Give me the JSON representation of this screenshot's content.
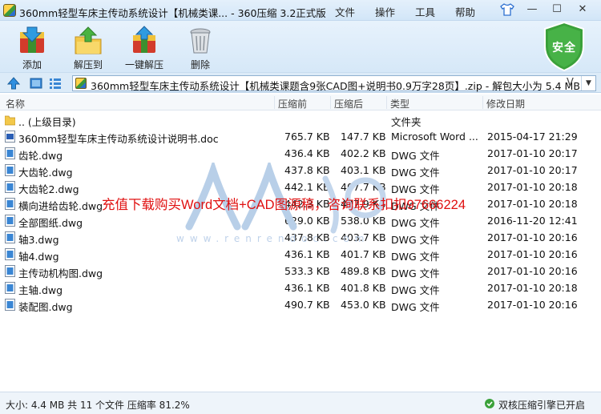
{
  "window": {
    "title": "360mm轻型车床主传动系统设计【机械类课... - 360压缩 3.2正式版",
    "menu": [
      "文件",
      "操作",
      "工具",
      "帮助"
    ],
    "controls": {
      "minimize": "—",
      "maximize": "☐",
      "close": "✕"
    }
  },
  "toolbar": {
    "add": "添加",
    "extract_to": "解压到",
    "one_click_extract": "一键解压",
    "delete": "删除"
  },
  "security_badge": "安全",
  "address": {
    "path": "360mm轻型车床主传动系统设计【机械类课题含9张CAD图+说明书0.9万字28页】.zip - 解包大小为 5.4 MB",
    "chevron": "V"
  },
  "columns": {
    "name": "名称",
    "compressed": "压缩前",
    "packed": "压缩后",
    "type": "类型",
    "modified": "修改日期"
  },
  "files": [
    {
      "name": ".. (上级目录)",
      "size": "",
      "packed": "",
      "type": "文件夹",
      "date": "",
      "icon": "folder-icon"
    },
    {
      "name": "360mm轻型车床主传动系统设计说明书.doc",
      "size": "765.7 KB",
      "packed": "147.7 KB",
      "type": "Microsoft Word ...",
      "date": "2015-04-17 21:29",
      "icon": "doc-file-icon"
    },
    {
      "name": "齿轮.dwg",
      "size": "436.4 KB",
      "packed": "402.2 KB",
      "type": "DWG 文件",
      "date": "2017-01-10 20:17",
      "icon": "dwg-file-icon"
    },
    {
      "name": "大齿轮.dwg",
      "size": "437.8 KB",
      "packed": "403.1 KB",
      "type": "DWG 文件",
      "date": "2017-01-10 20:17",
      "icon": "dwg-file-icon"
    },
    {
      "name": "大齿轮2.dwg",
      "size": "442.1 KB",
      "packed": "407.7 KB",
      "type": "DWG 文件",
      "date": "2017-01-10 20:18",
      "icon": "dwg-file-icon"
    },
    {
      "name": "横向进给齿轮.dwg",
      "size": "442.3 KB",
      "packed": "407.9 KB",
      "type": "DWG 文件",
      "date": "2017-01-10 20:18",
      "icon": "dwg-file-icon"
    },
    {
      "name": "全部图纸.dwg",
      "size": "629.0 KB",
      "packed": "538.0 KB",
      "type": "DWG 文件",
      "date": "2016-11-20 12:41",
      "icon": "dwg-file-icon"
    },
    {
      "name": "轴3.dwg",
      "size": "437.8 KB",
      "packed": "403.7 KB",
      "type": "DWG 文件",
      "date": "2017-01-10 20:16",
      "icon": "dwg-file-icon"
    },
    {
      "name": "轴4.dwg",
      "size": "436.1 KB",
      "packed": "401.7 KB",
      "type": "DWG 文件",
      "date": "2017-01-10 20:16",
      "icon": "dwg-file-icon"
    },
    {
      "name": "主传动机构图.dwg",
      "size": "533.3 KB",
      "packed": "489.8 KB",
      "type": "DWG 文件",
      "date": "2017-01-10 20:16",
      "icon": "dwg-file-icon"
    },
    {
      "name": "主轴.dwg",
      "size": "436.1 KB",
      "packed": "401.8 KB",
      "type": "DWG 文件",
      "date": "2017-01-10 20:18",
      "icon": "dwg-file-icon"
    },
    {
      "name": "装配图.dwg",
      "size": "490.7 KB",
      "packed": "453.0 KB",
      "type": "DWG 文件",
      "date": "2017-01-10 20:16",
      "icon": "dwg-file-icon"
    }
  ],
  "watermark": {
    "promo": "充值下载购买Word文档+CAD图源稿，咨询联系扣扣97666224",
    "url": "www.renrendoc.com"
  },
  "status": {
    "summary": "大小: 4.4 MB 共 11 个文件 压缩率 81.2%",
    "engine": "双核压缩引擎已开启"
  },
  "colors": {
    "accent": "#2c6fd0",
    "security_green": "#3aa13a",
    "watermark_red": "#e01010"
  }
}
